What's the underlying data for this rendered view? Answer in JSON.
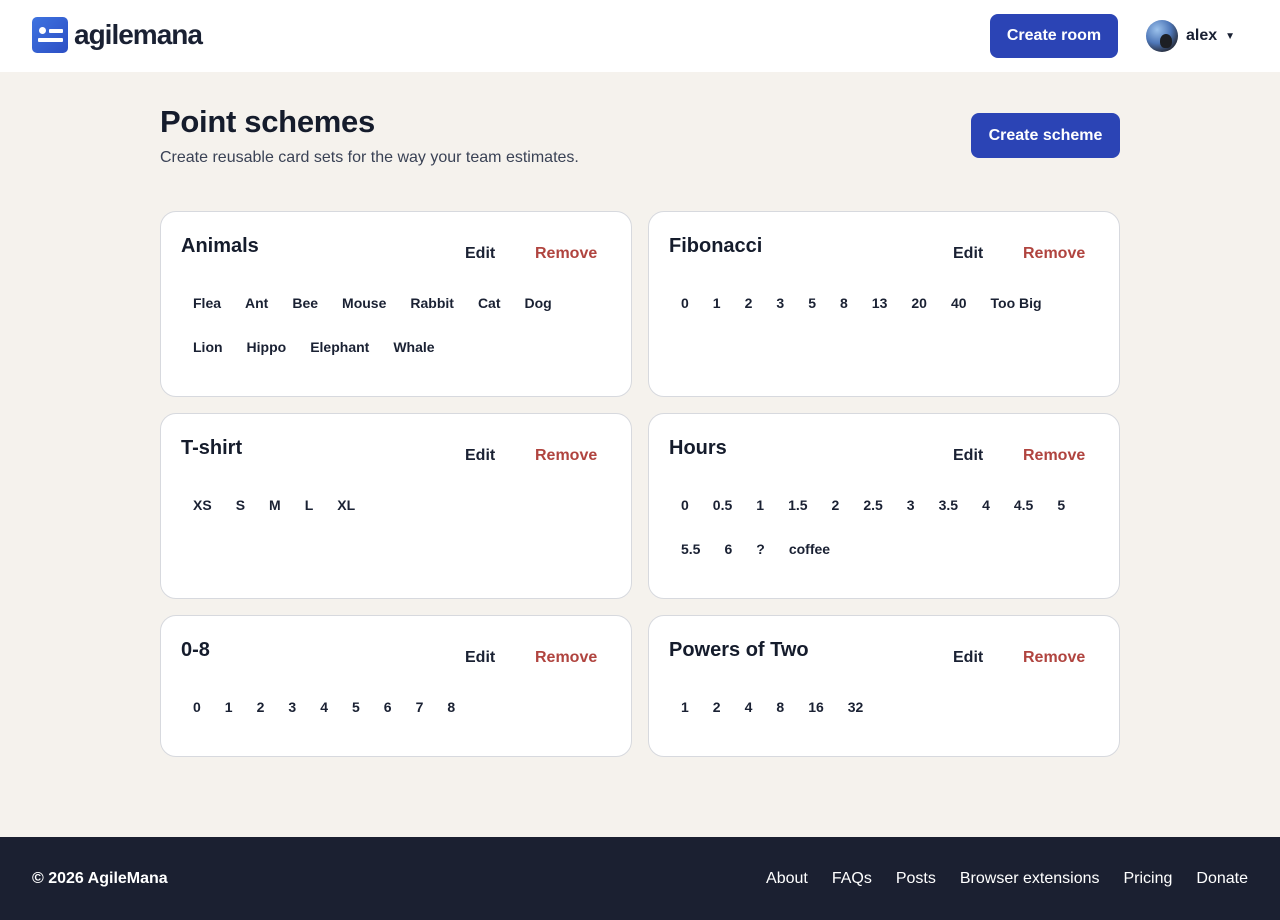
{
  "header": {
    "logo_text": "agilemana",
    "create_room_label": "Create room",
    "user_name": "alex"
  },
  "page": {
    "title": "Point schemes",
    "subtitle": "Create reusable card sets for the way your team estimates.",
    "create_scheme_label": "Create scheme"
  },
  "schemes": [
    {
      "name": "Animals",
      "edit_label": "Edit",
      "remove_label": "Remove",
      "values": [
        "Flea",
        "Ant",
        "Bee",
        "Mouse",
        "Rabbit",
        "Cat",
        "Dog",
        "Lion",
        "Hippo",
        "Elephant",
        "Whale"
      ]
    },
    {
      "name": "Fibonacci",
      "edit_label": "Edit",
      "remove_label": "Remove",
      "values": [
        "0",
        "1",
        "2",
        "3",
        "5",
        "8",
        "13",
        "20",
        "40",
        "Too Big"
      ]
    },
    {
      "name": "T-shirt",
      "edit_label": "Edit",
      "remove_label": "Remove",
      "values": [
        "XS",
        "S",
        "M",
        "L",
        "XL"
      ]
    },
    {
      "name": "Hours",
      "edit_label": "Edit",
      "remove_label": "Remove",
      "values": [
        "0",
        "0.5",
        "1",
        "1.5",
        "2",
        "2.5",
        "3",
        "3.5",
        "4",
        "4.5",
        "5",
        "5.5",
        "6",
        "?",
        "coffee"
      ]
    },
    {
      "name": "0-8",
      "edit_label": "Edit",
      "remove_label": "Remove",
      "values": [
        "0",
        "1",
        "2",
        "3",
        "4",
        "5",
        "6",
        "7",
        "8"
      ]
    },
    {
      "name": "Powers of Two",
      "edit_label": "Edit",
      "remove_label": "Remove",
      "values": [
        "1",
        "2",
        "4",
        "8",
        "16",
        "32"
      ]
    }
  ],
  "footer": {
    "copyright": "© 2026 AgileMana",
    "links": [
      "About",
      "FAQs",
      "Posts",
      "Browser extensions",
      "Pricing",
      "Donate"
    ]
  },
  "colors": {
    "primary": "#2b44b5",
    "danger": "#b0443f",
    "background": "#f5f2ed",
    "footer": "#1b2031"
  }
}
